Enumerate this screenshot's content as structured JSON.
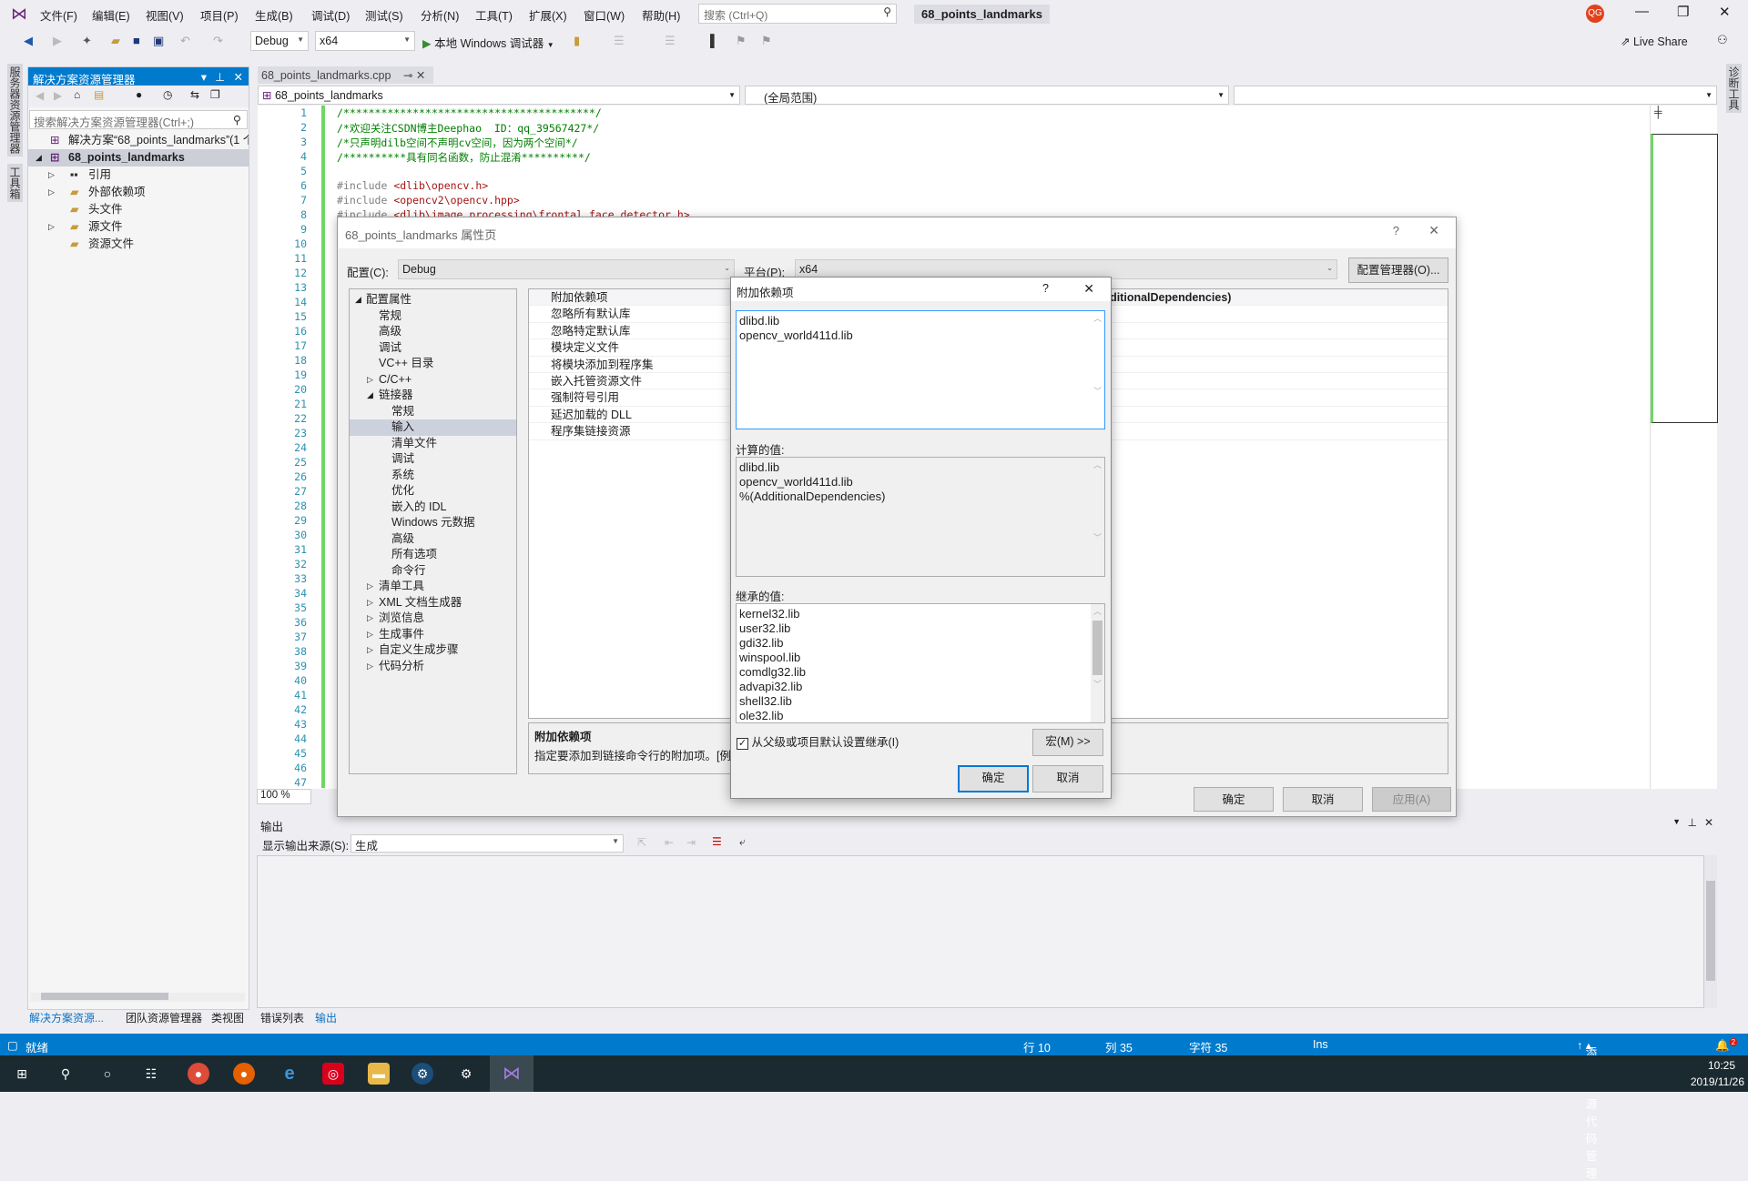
{
  "menubar": {
    "items": [
      "文件(F)",
      "编辑(E)",
      "视图(V)",
      "项目(P)",
      "生成(B)",
      "调试(D)",
      "测试(S)",
      "分析(N)",
      "工具(T)",
      "扩展(X)",
      "窗口(W)",
      "帮助(H)"
    ],
    "search_placeholder": "搜索 (Ctrl+Q)",
    "solution_title": "68_points_landmarks",
    "avatar": "QG"
  },
  "toolbar": {
    "config": "Debug",
    "platform": "x64",
    "run_label": "本地 Windows 调试器",
    "live_share": "Live Share"
  },
  "side_strip": {
    "server_explorer": "服务器资源管理器",
    "toolbox": "工具箱",
    "diagnostics": "诊断工具"
  },
  "solution_explorer": {
    "title": "解决方案资源管理器",
    "search_placeholder": "搜索解决方案资源管理器(Ctrl+;)",
    "tree": [
      {
        "label": "解决方案“68_points_landmarks”(1 个项目)",
        "level": 0,
        "arrow": ""
      },
      {
        "label": "68_points_landmarks",
        "level": 0,
        "arrow": "◢",
        "selected": true
      },
      {
        "label": "引用",
        "level": 1,
        "arrow": "▷"
      },
      {
        "label": "外部依赖项",
        "level": 1,
        "arrow": "▷"
      },
      {
        "label": "头文件",
        "level": 1,
        "arrow": ""
      },
      {
        "label": "源文件",
        "level": 1,
        "arrow": "▷"
      },
      {
        "label": "资源文件",
        "level": 1,
        "arrow": ""
      }
    ],
    "bottom_tabs": [
      "解决方案资源...",
      "团队资源管理器",
      "类视图",
      "错误列表",
      "输出"
    ]
  },
  "editor": {
    "tab": "68_points_landmarks.cpp",
    "nav_project": "68_points_landmarks",
    "nav_scope": "(全局范围)",
    "zoom": "100 %",
    "lines": [
      [
        {
          "t": "/****************************************/",
          "c": "#008000"
        }
      ],
      [
        {
          "t": "/*欢迎关注CSDN博主Deephao  ID：qq_39567427*/",
          "c": "#008000"
        }
      ],
      [
        {
          "t": "/*只声明dilb空间不声明cv空间，因为两个空间*/",
          "c": "#008000"
        }
      ],
      [
        {
          "t": "/**********具有同名函数，防止混淆**********/",
          "c": "#008000"
        }
      ],
      [],
      [
        {
          "t": "#include ",
          "c": "#808080"
        },
        {
          "t": "<dlib\\opencv.h>",
          "c": "#a31515"
        }
      ],
      [
        {
          "t": "#include ",
          "c": "#808080"
        },
        {
          "t": "<opencv2\\opencv.hpp>",
          "c": "#a31515"
        }
      ],
      [
        {
          "t": "#include ",
          "c": "#808080"
        },
        {
          "t": "<dlib\\image_processing\\frontal_face_detector.h>",
          "c": "#a31515"
        }
      ]
    ],
    "line_count": 47
  },
  "output": {
    "title": "输出",
    "source_label": "显示输出来源(S):",
    "source": "生成"
  },
  "prop_dialog": {
    "title": "68_points_landmarks 属性页",
    "config_label": "配置(C):",
    "config": "Debug",
    "platform_label": "平台(P):",
    "platform": "x64",
    "config_manager": "配置管理器(O)...",
    "tree": [
      [
        "配置属性",
        0,
        "◢"
      ],
      [
        "常规",
        1,
        ""
      ],
      [
        "高级",
        1,
        ""
      ],
      [
        "调试",
        1,
        ""
      ],
      [
        "VC++ 目录",
        1,
        ""
      ],
      [
        "C/C++",
        1,
        "▷"
      ],
      [
        "链接器",
        1,
        "◢"
      ],
      [
        "常规",
        2,
        ""
      ],
      [
        "输入",
        2,
        "",
        "sel"
      ],
      [
        "清单文件",
        2,
        ""
      ],
      [
        "调试",
        2,
        ""
      ],
      [
        "系统",
        2,
        ""
      ],
      [
        "优化",
        2,
        ""
      ],
      [
        "嵌入的 IDL",
        2,
        ""
      ],
      [
        "Windows 元数据",
        2,
        ""
      ],
      [
        "高级",
        2,
        ""
      ],
      [
        "所有选项",
        2,
        ""
      ],
      [
        "命令行",
        2,
        ""
      ],
      [
        "清单工具",
        1,
        "▷"
      ],
      [
        "XML 文档生成器",
        1,
        "▷"
      ],
      [
        "浏览信息",
        1,
        "▷"
      ],
      [
        "生成事件",
        1,
        "▷"
      ],
      [
        "自定义生成步骤",
        1,
        "▷"
      ],
      [
        "代码分析",
        1,
        "▷"
      ]
    ],
    "properties": [
      {
        "name": "附加依赖项",
        "value": "dlibd.lib;opencv_world411d.lib;%(AdditionalDependencies)"
      },
      {
        "name": "忽略所有默认库",
        "value": ""
      },
      {
        "name": "忽略特定默认库",
        "value": ""
      },
      {
        "name": "模块定义文件",
        "value": ""
      },
      {
        "name": "将模块添加到程序集",
        "value": ""
      },
      {
        "name": "嵌入托管资源文件",
        "value": ""
      },
      {
        "name": "强制符号引用",
        "value": ""
      },
      {
        "name": "延迟加载的 DLL",
        "value": ""
      },
      {
        "name": "程序集链接资源",
        "value": ""
      }
    ],
    "desc_title": "附加依赖项",
    "desc_text": "指定要添加到链接命令行的附加项。[例如 kernel32.lib]",
    "ok": "确定",
    "cancel": "取消",
    "apply": "应用(A)",
    "help": "?"
  },
  "deps_dialog": {
    "title": "附加依赖项",
    "help": "?",
    "edit_values": [
      "dlibd.lib",
      "opencv_world411d.lib"
    ],
    "computed_label": "计算的值:",
    "computed_values": [
      "dlibd.lib",
      "opencv_world411d.lib",
      "%(AdditionalDependencies)"
    ],
    "inherited_label": "继承的值:",
    "inherited_values": [
      "kernel32.lib",
      "user32.lib",
      "gdi32.lib",
      "winspool.lib",
      "comdlg32.lib",
      "advapi32.lib",
      "shell32.lib",
      "ole32.lib"
    ],
    "inherit_checkbox": "从父级或项目默认设置继承(I)",
    "inherit_checked": true,
    "macros": "宏(M) >>",
    "ok": "确定",
    "cancel": "取消"
  },
  "status": {
    "ready": "就绪",
    "line": "行 10",
    "col": "列 35",
    "char": "字符 35",
    "ins": "Ins",
    "source_control": "添加到源代码管理",
    "notifications": "2"
  },
  "taskbar": {
    "time": "10:25",
    "date": "2019/11/26"
  },
  "colors": {
    "accent": "#007acc",
    "avatar": "#e0431c",
    "vs_purple": "#865fc5"
  }
}
